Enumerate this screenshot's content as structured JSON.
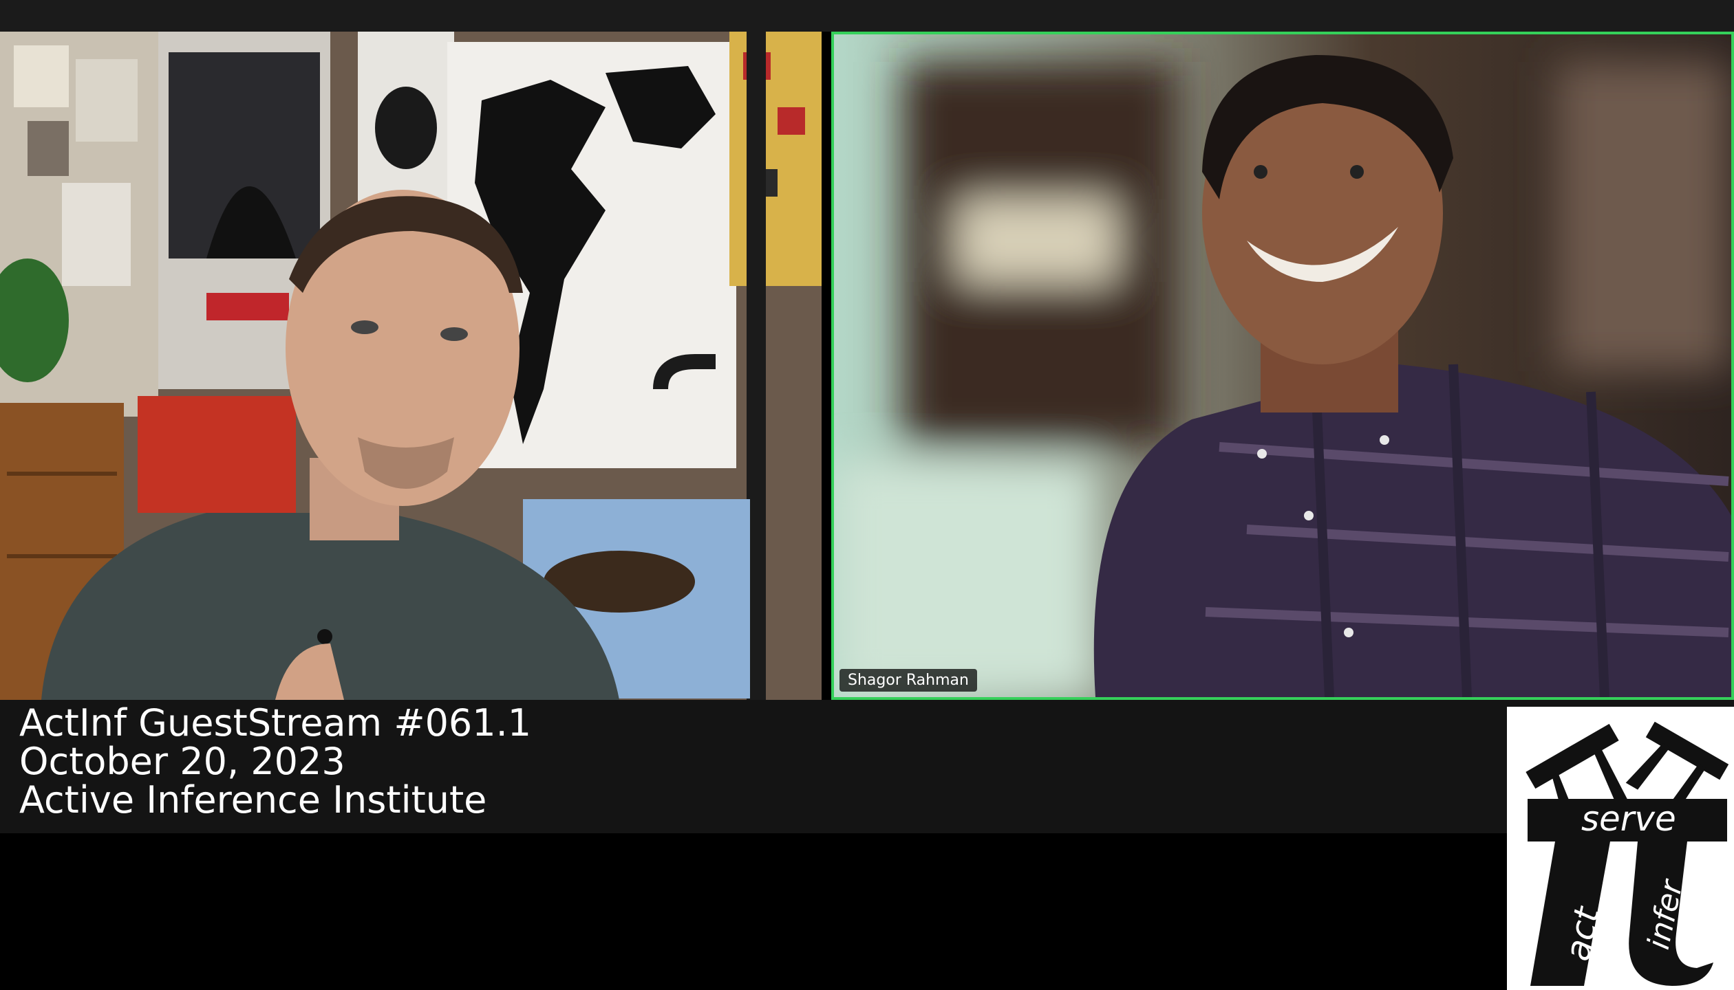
{
  "participants": [
    {
      "name": ""
    },
    {
      "name": "Shagor Rahman"
    }
  ],
  "caption": {
    "line1": "ActInf GuestStream #061.1",
    "line2": "October 20, 2023",
    "line3": "Active Inference Institute"
  },
  "logo": {
    "word_top": "serve",
    "word_left": "act",
    "word_right": "infer"
  },
  "colors": {
    "active_speaker_border": "#35d05a",
    "caption_band": "#141414",
    "background": "#000000"
  }
}
